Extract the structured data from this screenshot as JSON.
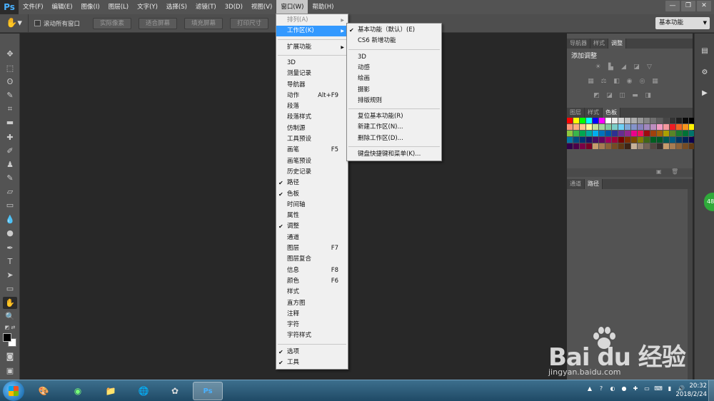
{
  "app": {
    "logo": "Ps"
  },
  "menubar": {
    "items": [
      "文件(F)",
      "编辑(E)",
      "图像(I)",
      "图层(L)",
      "文字(Y)",
      "选择(S)",
      "滤镜(T)",
      "3D(D)",
      "视图(V)",
      "窗口(W)",
      "帮助(H)"
    ],
    "active_index": 9
  },
  "window_controls": {
    "minimize": "—",
    "restore": "❐",
    "close": "✕"
  },
  "options_bar": {
    "scroll_all_label": "滚动所有窗口",
    "buttons": [
      "实际像素",
      "适合屏幕",
      "填充屏幕",
      "打印尺寸"
    ],
    "workspace": "基本功能"
  },
  "window_menu": {
    "items": [
      {
        "label": "排列(A)",
        "state": "disabled",
        "submenu": true
      },
      {
        "label": "工作区(K)",
        "state": "highlighted",
        "submenu": true
      },
      {
        "sep": true
      },
      {
        "label": "扩展功能",
        "submenu": true
      },
      {
        "sep": true
      },
      {
        "label": "3D"
      },
      {
        "label": "测量记录"
      },
      {
        "label": "导航器"
      },
      {
        "label": "动作",
        "shortcut": "Alt+F9"
      },
      {
        "label": "段落"
      },
      {
        "label": "段落样式"
      },
      {
        "label": "仿制源"
      },
      {
        "label": "工具预设"
      },
      {
        "label": "画笔",
        "shortcut": "F5"
      },
      {
        "label": "画笔预设"
      },
      {
        "label": "历史记录"
      },
      {
        "label": "路径",
        "checked": true
      },
      {
        "label": "色板",
        "checked": true
      },
      {
        "label": "时间轴"
      },
      {
        "label": "属性"
      },
      {
        "label": "调整",
        "checked": true
      },
      {
        "label": "通道"
      },
      {
        "label": "图层",
        "shortcut": "F7"
      },
      {
        "label": "图层复合"
      },
      {
        "label": "信息",
        "shortcut": "F8"
      },
      {
        "label": "颜色",
        "shortcut": "F6"
      },
      {
        "label": "样式"
      },
      {
        "label": "直方图"
      },
      {
        "label": "注释"
      },
      {
        "label": "字符"
      },
      {
        "label": "字符样式"
      },
      {
        "sep": true
      },
      {
        "label": "选项",
        "checked": true
      },
      {
        "label": "工具",
        "checked": true
      }
    ]
  },
  "workspace_submenu": {
    "items": [
      {
        "label": "基本功能（默认）(E)",
        "checked": true
      },
      {
        "label": "CS6 新增功能"
      },
      {
        "sep": true
      },
      {
        "label": "3D"
      },
      {
        "label": "动感"
      },
      {
        "label": "绘画"
      },
      {
        "label": "摄影"
      },
      {
        "label": "排版规则"
      },
      {
        "sep": true
      },
      {
        "label": "复位基本功能(R)"
      },
      {
        "label": "新建工作区(N)..."
      },
      {
        "label": "删除工作区(D)..."
      },
      {
        "sep": true
      },
      {
        "label": "键盘快捷键和菜单(K)..."
      }
    ]
  },
  "panels": {
    "top_tabs": [
      "导航器",
      "样式",
      "调整"
    ],
    "adjust_title": "添加调整",
    "middle_tabs": [
      "图层",
      "样式",
      "色板"
    ],
    "bottom_tabs": [
      "通道",
      "路径"
    ]
  },
  "swatches": [
    "#ff0000",
    "#ffff00",
    "#00ff00",
    "#00ffff",
    "#0000ff",
    "#ff00ff",
    "#ffffff",
    "#ebebeb",
    "#d6d6d6",
    "#c2c2c2",
    "#adadad",
    "#999999",
    "#858585",
    "#707070",
    "#5c5c5c",
    "#474747",
    "#333333",
    "#1f1f1f",
    "#0a0a0a",
    "#000000",
    "#f7977a",
    "#f9ad81",
    "#fdc68a",
    "#fff79a",
    "#c4df9b",
    "#a2d39c",
    "#82ca9d",
    "#7bcdc8",
    "#6ecff6",
    "#7ea7d8",
    "#8493ca",
    "#8882be",
    "#a187be",
    "#bc8dbf",
    "#f49ac2",
    "#f6989d",
    "#ed1c24",
    "#f26522",
    "#f7941d",
    "#fff200",
    "#8dc73f",
    "#39b54a",
    "#00a651",
    "#00a99d",
    "#00aeef",
    "#0072bc",
    "#0054a6",
    "#2e3192",
    "#662d91",
    "#92278f",
    "#ec008c",
    "#ed145b",
    "#9e0b0f",
    "#a0410d",
    "#a36209",
    "#aba000",
    "#598527",
    "#1a7b30",
    "#007236",
    "#00746b",
    "#0076a3",
    "#004b80",
    "#003471",
    "#1b1464",
    "#440e62",
    "#630460",
    "#9e005d",
    "#9e0039",
    "#790000",
    "#7b2e00",
    "#7d4900",
    "#827b00",
    "#406618",
    "#005e20",
    "#005826",
    "#005952",
    "#005b7f",
    "#003663",
    "#002157",
    "#0d004c",
    "#32004b",
    "#4b0049",
    "#7b0046",
    "#7a0026",
    "#c69c6d",
    "#a67c52",
    "#8c6239",
    "#754c24",
    "#603913",
    "#3c2415",
    "#c7b299",
    "#998675",
    "#736357",
    "#534741",
    "#362f2d",
    "#c69c6d",
    "#a67c52",
    "#8c6239",
    "#754c24",
    "#603913"
  ],
  "taskbar": {
    "time": "20:32",
    "date": "2018/2/24"
  },
  "watermark": {
    "brand": "Bai du 经验",
    "url": "jingyan.baidu.com"
  },
  "badge": "48"
}
